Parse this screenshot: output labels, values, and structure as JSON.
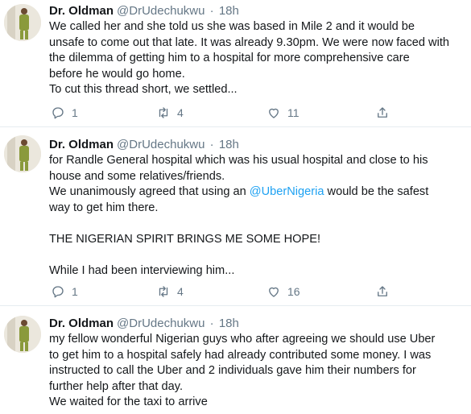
{
  "tweets": [
    {
      "name": "Dr. Oldman",
      "handle": "@DrUdechukwu",
      "separator": "·",
      "time": "18h",
      "lines": [
        "We called her and she told us she was based in Mile 2 and it would be",
        "unsafe to come out that late. It was already 9.30pm. We were now faced with",
        "the dilemma of getting him to a hospital for more comprehensive care",
        "before he would go home.",
        "To cut this thread short, we settled..."
      ],
      "replies": "1",
      "retweets": "4",
      "likes": "11"
    },
    {
      "name": "Dr. Oldman",
      "handle": "@DrUdechukwu",
      "separator": "·",
      "time": "18h",
      "lines": [
        "for Randle General hospital which was his usual hospital and close to his",
        "house and some relatives/friends.",
        "We unanimously agreed that using an ",
        "@UberNigeria",
        " would be the safest",
        "way to get him there.",
        "THE NIGERIAN SPIRIT BRINGS ME SOME HOPE!",
        "While I had been interviewing him..."
      ],
      "replies": "1",
      "retweets": "4",
      "likes": "16"
    },
    {
      "name": "Dr. Oldman",
      "handle": "@DrUdechukwu",
      "separator": "·",
      "time": "18h",
      "lines": [
        "my fellow wonderful Nigerian guys who after agreeing we should use Uber",
        "to get him to a hospital safely had already contributed some money. I was",
        "instructed to call the Uber and 2 individuals gave him their numbers for",
        "further help after that day.",
        "We waited for the taxi to arrive"
      ]
    }
  ],
  "icons": [
    "avatar-icon",
    "reply-icon",
    "retweet-icon",
    "like-icon",
    "share-icon"
  ],
  "colors": {
    "name": "#14171a",
    "meta": "#657786",
    "link": "#1da1f2",
    "divider": "#e6ecf0"
  }
}
